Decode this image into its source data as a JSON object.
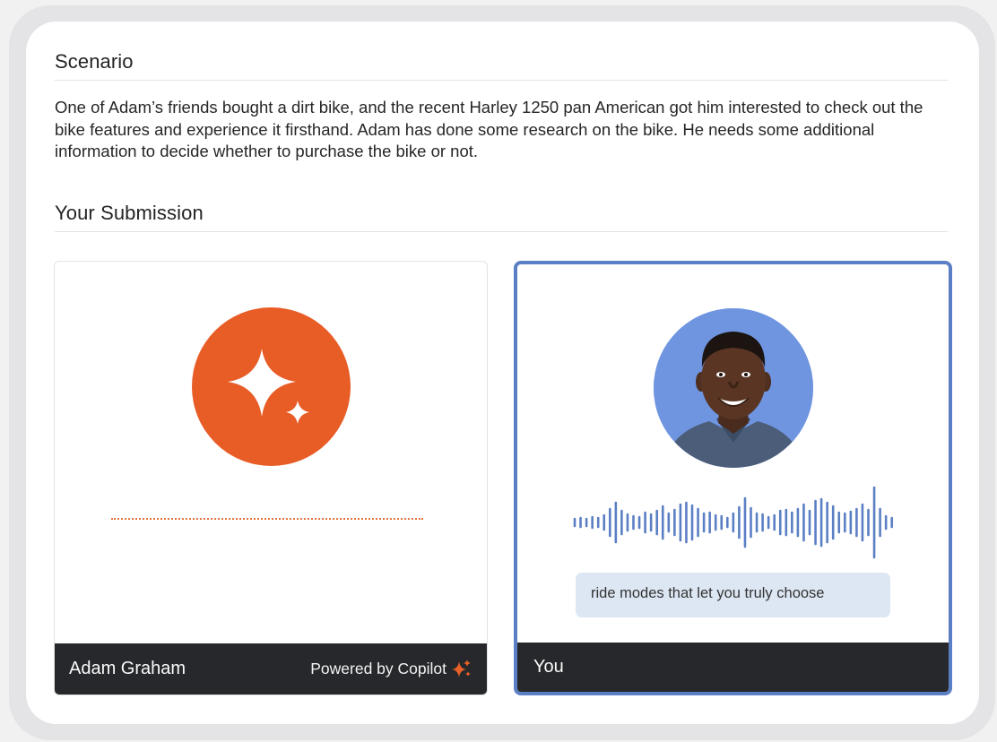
{
  "scenario": {
    "title": "Scenario",
    "text": "One of Adam’s friends bought a dirt bike, and the recent Harley 1250 pan American got him interested to check out the bike features and experience it firsthand. Adam has done some research on the bike. He needs some additional information to decide whether to purchase the bike or not."
  },
  "submission": {
    "title": "Your Submission"
  },
  "left_panel": {
    "name": "Adam Graham",
    "powered_by": "Powered by Copilot",
    "icon": "copilot-sparkle-icon",
    "accent_color": "#e85c26"
  },
  "right_panel": {
    "name": "You",
    "caption": "ride modes that let you truly choose",
    "icon": "user-avatar",
    "accent_color": "#5b7fc4"
  }
}
